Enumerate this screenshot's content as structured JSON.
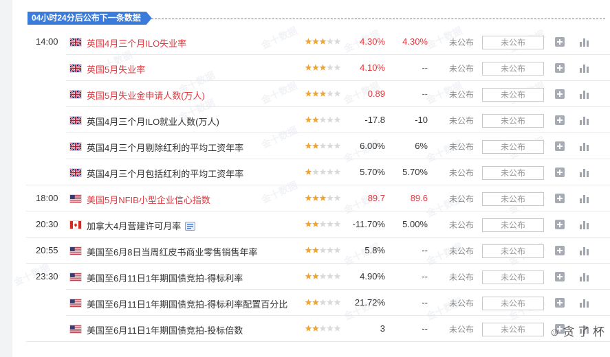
{
  "banner": {
    "text": "04小时24分后公布下一条数据"
  },
  "watermark": "金十数据",
  "corner": {
    "icon": "wechat-logo-icon",
    "text": "贪 了 杯"
  },
  "colors": {
    "accent": "#3b7bd9",
    "important": "#e0383e",
    "star": "#f0a431",
    "star_off": "#d9d9d9"
  },
  "rows": [
    {
      "time": "14:00",
      "country": "UK",
      "name": "英国4月三个月ILO失业率",
      "stars": 3,
      "prev": "4.30%",
      "forecast": "4.30%",
      "actual": "未公布",
      "box": "未公布",
      "important": true,
      "group_end": false
    },
    {
      "time": "",
      "country": "UK",
      "name": "英国5月失业率",
      "stars": 3,
      "prev": "4.10%",
      "forecast": "--",
      "actual": "未公布",
      "box": "未公布",
      "important": true,
      "group_end": false
    },
    {
      "time": "",
      "country": "UK",
      "name": "英国5月失业金申请人数(万人)",
      "stars": 3,
      "prev": "0.89",
      "forecast": "--",
      "actual": "未公布",
      "box": "未公布",
      "important": true,
      "group_end": false
    },
    {
      "time": "",
      "country": "UK",
      "name": "英国4月三个月ILO就业人数(万人)",
      "stars": 2,
      "prev": "-17.8",
      "forecast": "-10",
      "actual": "未公布",
      "box": "未公布",
      "important": false,
      "group_end": false
    },
    {
      "time": "",
      "country": "UK",
      "name": "英国4月三个月剔除红利的平均工资年率",
      "stars": 2,
      "prev": "6.00%",
      "forecast": "6%",
      "actual": "未公布",
      "box": "未公布",
      "important": false,
      "group_end": false
    },
    {
      "time": "",
      "country": "UK",
      "name": "英国4月三个月包括红利的平均工资年率",
      "stars": 1,
      "prev": "5.70%",
      "forecast": "5.70%",
      "actual": "未公布",
      "box": "未公布",
      "important": false,
      "group_end": true
    },
    {
      "time": "18:00",
      "country": "US",
      "name": "美国5月NFIB小型企业信心指数",
      "stars": 3,
      "prev": "89.7",
      "forecast": "89.6",
      "actual": "未公布",
      "box": "未公布",
      "important": true,
      "group_end": true
    },
    {
      "time": "20:30",
      "country": "CA",
      "name": "加拿大4月营建许可月率",
      "stars": 2,
      "prev": "-11.70%",
      "forecast": "5.00%",
      "actual": "未公布",
      "box": "未公布",
      "important": false,
      "group_end": true,
      "report": true
    },
    {
      "time": "20:55",
      "country": "US",
      "name": "美国至6月8日当周红皮书商业零售销售年率",
      "stars": 2,
      "prev": "5.8%",
      "forecast": "--",
      "actual": "未公布",
      "box": "未公布",
      "important": false,
      "group_end": true
    },
    {
      "time": "23:30",
      "country": "US",
      "name": "美国至6月11日1年期国债竞拍-得标利率",
      "stars": 2,
      "prev": "4.90%",
      "forecast": "--",
      "actual": "未公布",
      "box": "未公布",
      "important": false,
      "group_end": false
    },
    {
      "time": "",
      "country": "US",
      "name": "美国至6月11日1年期国债竞拍-得标利率配置百分比",
      "stars": 2,
      "prev": "21.72%",
      "forecast": "--",
      "actual": "未公布",
      "box": "未公布",
      "important": false,
      "group_end": false
    },
    {
      "time": "",
      "country": "US",
      "name": "美国至6月11日1年期国债竞拍-投标倍数",
      "stars": 2,
      "prev": "3",
      "forecast": "--",
      "actual": "未公布",
      "box": "未公布",
      "important": false,
      "group_end": true
    }
  ]
}
